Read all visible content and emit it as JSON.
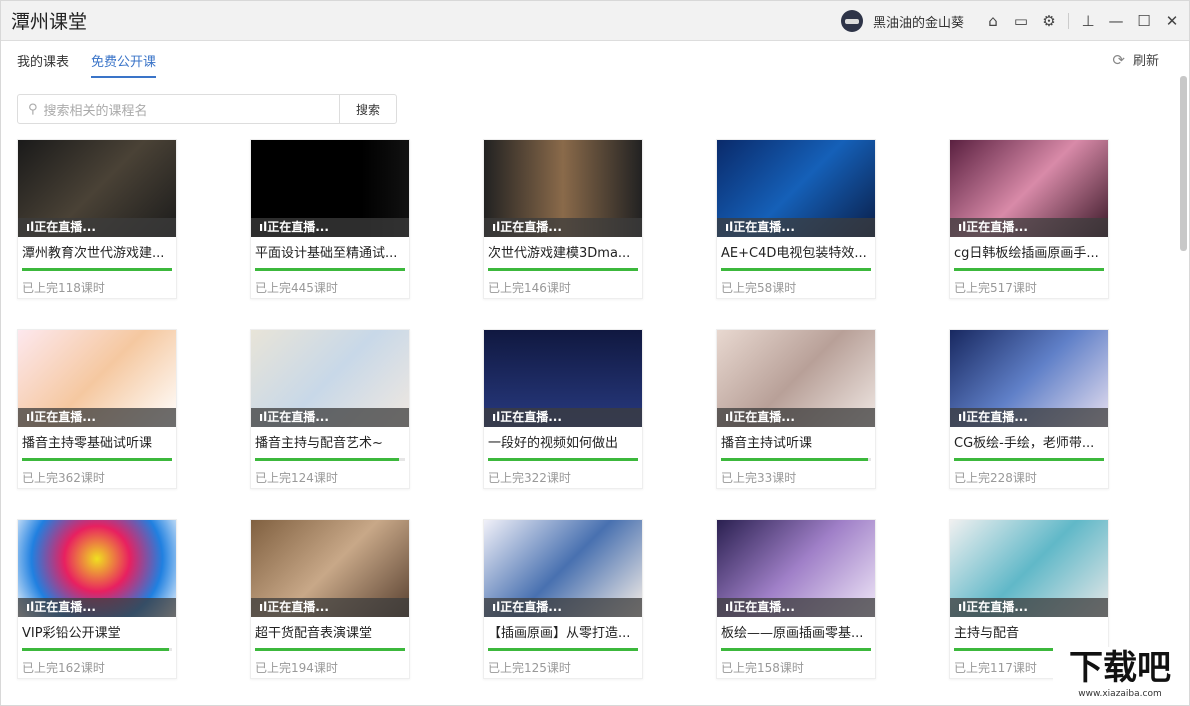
{
  "app": {
    "title": "潭州课堂",
    "username": "黑油油的金山葵"
  },
  "tabs": [
    {
      "label": "我的课表"
    },
    {
      "label": "免费公开课"
    }
  ],
  "refresh_label": "刷新",
  "search": {
    "placeholder": "搜索相关的课程名",
    "button": "搜索"
  },
  "live_label": "正在直播...",
  "courses": [
    {
      "title": "潭州教育次世代游戏建...",
      "count": "已上完118课时",
      "progress": 100,
      "bg": "linear-gradient(135deg,#1a1a1a,#4a4236,#1b1b1b)"
    },
    {
      "title": "平面设计基础至精通试...",
      "count": "已上完445课时",
      "progress": 100,
      "bg": "linear-gradient(90deg,#000 70%,#111)"
    },
    {
      "title": "次世代游戏建模3Dma...",
      "count": "已上完146课时",
      "progress": 100,
      "bg": "linear-gradient(90deg,#222,#8a6a4a,#222)"
    },
    {
      "title": "AE+C4D电视包装特效...",
      "count": "已上完58课时",
      "progress": 100,
      "bg": "linear-gradient(135deg,#0a2a6a,#1560b8,#0a1e48)"
    },
    {
      "title": "cg日韩板绘插画原画手...",
      "count": "已上完517课时",
      "progress": 100,
      "bg": "linear-gradient(135deg,#5a2040,#d88aa8,#3a1828)"
    },
    {
      "title": "播音主持零基础试听课",
      "count": "已上完362课时",
      "progress": 100,
      "bg": "linear-gradient(135deg,#fde8ee,#f5c8a0,#fff)"
    },
    {
      "title": "播音主持与配音艺术~",
      "count": "已上完124课时",
      "progress": 96,
      "bg": "linear-gradient(135deg,#e8e4d8,#c8d8e8,#f0e8e0)"
    },
    {
      "title": "一段好的视频如何做出",
      "count": "已上完322课时",
      "progress": 100,
      "bg": "linear-gradient(180deg,#101840,#283a80)"
    },
    {
      "title": "播音主持试听课",
      "count": "已上完33课时",
      "progress": 98,
      "bg": "linear-gradient(135deg,#e8d8d0,#b8a098,#f0e8e4)"
    },
    {
      "title": "CG板绘-手绘，老师带...",
      "count": "已上完228课时",
      "progress": 100,
      "bg": "linear-gradient(135deg,#182860,#6080c8,#e8e0f0)"
    },
    {
      "title": "VIP彩铅公开课堂",
      "count": "已上完162课时",
      "progress": 98,
      "bg": "radial-gradient(circle at 50% 40%,#f0e020,#e82060,#2080e0,#fff)"
    },
    {
      "title": "超干货配音表演课堂",
      "count": "已上完194课时",
      "progress": 100,
      "bg": "linear-gradient(135deg,#806040,#c8a888,#584030)"
    },
    {
      "title": "【插画原画】从零打造...",
      "count": "已上完125课时",
      "progress": 100,
      "bg": "linear-gradient(135deg,#f0f0f8,#4870b0,#f8f0e8)"
    },
    {
      "title": "板绘——原画插画零基...",
      "count": "已上完158课时",
      "progress": 100,
      "bg": "linear-gradient(135deg,#2a2050,#a080c8,#f0e8f8)"
    },
    {
      "title": "主持与配音",
      "count": "已上完117课时",
      "progress": 97,
      "bg": "linear-gradient(135deg,#f0f0f0,#60b8c8,#e8e8e8)"
    }
  ],
  "watermark": {
    "text": "下载吧",
    "url": "www.xiazaiba.com"
  }
}
